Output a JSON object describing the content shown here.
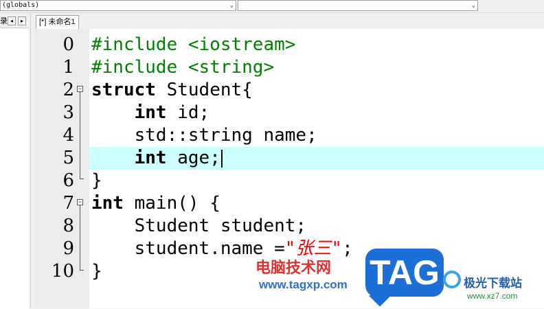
{
  "toolbar": {
    "scope_combo_value": "(globals)",
    "symbol_combo_value": ""
  },
  "left_panel": {
    "label": "录",
    "nav_prev": "◂",
    "nav_next": "▸"
  },
  "tabs": [
    {
      "label": "[*] 未命名1"
    }
  ],
  "editor": {
    "current_line": 5,
    "lines": [
      {
        "num": "0",
        "segments": [
          {
            "text": "#include <iostream>",
            "style": "pp"
          }
        ]
      },
      {
        "num": "1",
        "segments": [
          {
            "text": "#include <string>",
            "style": "pp"
          }
        ]
      },
      {
        "num": "2",
        "segments": [
          {
            "text": "struct",
            "style": "kw"
          },
          {
            "text": " Student{",
            "style": ""
          }
        ]
      },
      {
        "num": "3",
        "segments": [
          {
            "text": "    ",
            "style": ""
          },
          {
            "text": "int",
            "style": "kw"
          },
          {
            "text": " id;",
            "style": ""
          }
        ]
      },
      {
        "num": "4",
        "segments": [
          {
            "text": "    std::string name;",
            "style": ""
          }
        ]
      },
      {
        "num": "5",
        "segments": [
          {
            "text": "    ",
            "style": ""
          },
          {
            "text": "int",
            "style": "kw"
          },
          {
            "text": " age;",
            "style": ""
          }
        ]
      },
      {
        "num": "6",
        "segments": [
          {
            "text": "}",
            "style": ""
          }
        ]
      },
      {
        "num": "7",
        "segments": [
          {
            "text": "int",
            "style": "kw"
          },
          {
            "text": " main() {",
            "style": ""
          }
        ]
      },
      {
        "num": "8",
        "segments": [
          {
            "text": "    Student student;",
            "style": ""
          }
        ]
      },
      {
        "num": "9",
        "segments": [
          {
            "text": "    student.name =",
            "style": ""
          },
          {
            "text": "\"张三\"",
            "style": "str"
          },
          {
            "text": ";",
            "style": ""
          }
        ]
      },
      {
        "num": "10",
        "segments": [
          {
            "text": "}",
            "style": ""
          }
        ]
      }
    ]
  },
  "watermarks": {
    "site_name": "电脑技术网",
    "site_url": "www.tagxp.com",
    "tag_logo": "TAG",
    "xz7_name": "极光下载站",
    "xz7_url": "www.xz7.com"
  }
}
